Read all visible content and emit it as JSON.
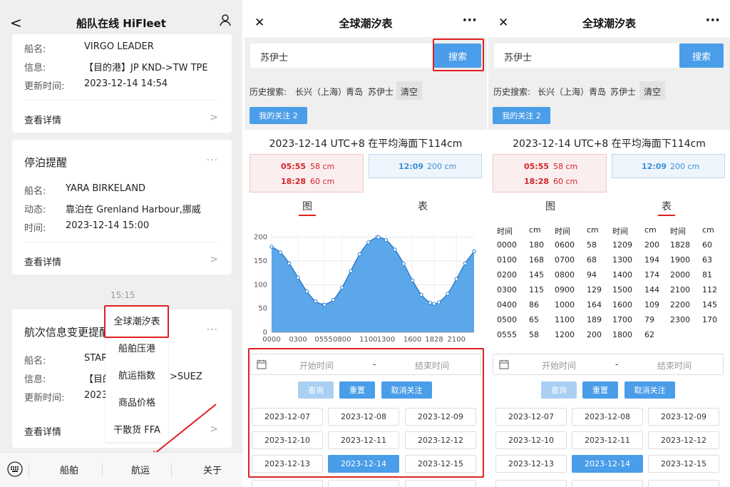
{
  "p1": {
    "title": "船队在线 HiFleet",
    "back": "<",
    "card1": {
      "ship_k": "船名:",
      "ship_v": "VIRGO LEADER",
      "info_k": "信息:",
      "info_v": "【目的港】JP KND->TW TPE",
      "time_k": "更新时间:",
      "time_v": "2023-12-14 14:54",
      "detail": "查看详情"
    },
    "card2": {
      "title": "停泊提醒",
      "ship_k": "船名:",
      "ship_v": "YARA BIRKELAND",
      "dyn_k": "动态:",
      "dyn_v": "靠泊在 Grenland Harbour,挪威",
      "time_k": "时间:",
      "time_v": "2023-12-14 15:00",
      "detail": "查看详情"
    },
    "time_sep": "15:15",
    "card3": {
      "title": "航次信息变更提醒",
      "ship_k": "船名:",
      "ship_v": "STAR",
      "info_k": "信息:",
      "info_v": "【目的",
      "info_v2": ">SUEZ",
      "time_k": "更新时间:",
      "time_v": "2023",
      "detail": "查看详情"
    },
    "menu": [
      "全球潮汐表",
      "船舶压港",
      "航运指数",
      "商品价格",
      "干散货 FFA"
    ],
    "nav": [
      "船舶",
      "航运",
      "关于"
    ],
    "dots": "···"
  },
  "tide": {
    "title": "全球潮汐表",
    "close": "✕",
    "more": "···",
    "search_value": "苏伊士",
    "search_btn": "搜索",
    "history_label": "历史搜索:",
    "history": [
      "长兴（上海）",
      "青岛",
      "苏伊士"
    ],
    "clear": "清空",
    "follow": "我的关注 2",
    "day_title": "2023-12-14 UTC+8 在平均海面下114cm",
    "lows": [
      {
        "t": "05:55",
        "v": "58 cm"
      },
      {
        "t": "18:28",
        "v": "60 cm"
      }
    ],
    "highs": [
      {
        "t": "12:09",
        "v": "200 cm"
      }
    ],
    "tab_chart": "图",
    "tab_table": "表",
    "start_ph": "开始时间",
    "end_ph": "结束时间",
    "dash": "-",
    "btn_query": "查询",
    "btn_reset": "重置",
    "btn_unfollow": "取消关注",
    "dates": [
      "2023-12-07",
      "2023-12-08",
      "2023-12-09",
      "2023-12-10",
      "2023-12-11",
      "2023-12-12",
      "2023-12-13",
      "2023-12-14",
      "2023-12-15"
    ],
    "selected_date": "2023-12-14",
    "colors": {
      "accent": "#4a9de8",
      "low": "#d0242c",
      "high": "#3a8fd8",
      "highlight": "#e02020"
    }
  },
  "chart_data": {
    "type": "area",
    "x": [
      "0000",
      "0100",
      "0200",
      "0300",
      "0400",
      "0500",
      "0555",
      "0600",
      "0700",
      "0800",
      "0900",
      "1000",
      "1100",
      "1200",
      "1209",
      "1300",
      "1400",
      "1500",
      "1600",
      "1700",
      "1800",
      "1828",
      "1900",
      "2000",
      "2100",
      "2200",
      "2300"
    ],
    "values": [
      180,
      168,
      145,
      115,
      86,
      65,
      58,
      58,
      68,
      94,
      129,
      164,
      189,
      200,
      200,
      194,
      174,
      144,
      109,
      79,
      62,
      60,
      63,
      81,
      112,
      145,
      170
    ],
    "x_tick_labels": [
      "0000",
      "0300",
      "0555",
      "0800",
      "1100",
      "1300",
      "1600",
      "1828",
      "2100"
    ],
    "y_ticks": [
      0,
      50,
      100,
      150,
      200
    ],
    "ylim": [
      0,
      210
    ],
    "color": "#4a9de8",
    "grid": true
  },
  "table": {
    "headers": [
      "时间",
      "cm",
      "时间",
      "cm",
      "时间",
      "cm",
      "时间",
      "cm"
    ],
    "columns": [
      [
        [
          "0000",
          "180"
        ],
        [
          "0100",
          "168"
        ],
        [
          "0200",
          "145"
        ],
        [
          "0300",
          "115"
        ],
        [
          "0400",
          "86"
        ],
        [
          "0500",
          "65"
        ],
        [
          "0555",
          "58"
        ]
      ],
      [
        [
          "0600",
          "58"
        ],
        [
          "0700",
          "68"
        ],
        [
          "0800",
          "94"
        ],
        [
          "0900",
          "129"
        ],
        [
          "1000",
          "164"
        ],
        [
          "1100",
          "189"
        ],
        [
          "1200",
          "200"
        ]
      ],
      [
        [
          "1209",
          "200"
        ],
        [
          "1300",
          "194"
        ],
        [
          "1400",
          "174"
        ],
        [
          "1500",
          "144"
        ],
        [
          "1600",
          "109"
        ],
        [
          "1700",
          "79"
        ],
        [
          "1800",
          "62"
        ]
      ],
      [
        [
          "1828",
          "60"
        ],
        [
          "1900",
          "63"
        ],
        [
          "2000",
          "81"
        ],
        [
          "2100",
          "112"
        ],
        [
          "2200",
          "145"
        ],
        [
          "2300",
          "170"
        ]
      ]
    ]
  }
}
